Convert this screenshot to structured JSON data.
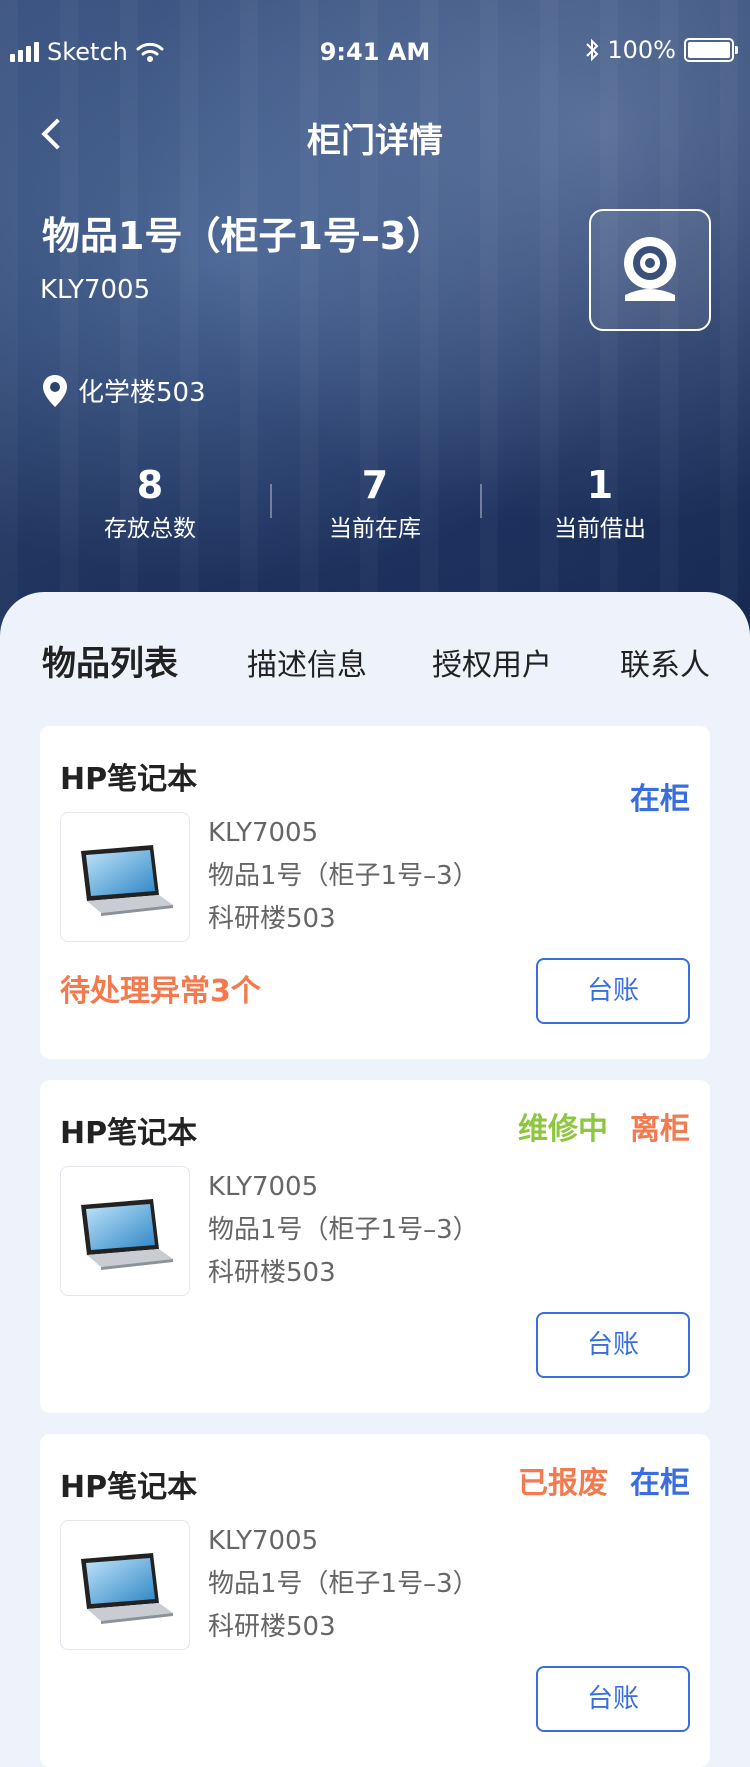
{
  "statusbar": {
    "carrier": "Sketch",
    "time": "9:41 AM",
    "battery": "100%"
  },
  "nav": {
    "title": "柜门详情"
  },
  "cabinet": {
    "title": "物品1号（柜子1号–3）",
    "code": "KLY7005",
    "location": "化学楼503"
  },
  "stats": [
    {
      "value": "8",
      "label": "存放总数"
    },
    {
      "value": "7",
      "label": "当前在库"
    },
    {
      "value": "1",
      "label": "当前借出"
    }
  ],
  "tabs": [
    "物品列表",
    "描述信息",
    "授权用户",
    "联系人"
  ],
  "colors": {
    "blue": "#3a6ee0",
    "orange": "#f27a4e",
    "green": "#8dc63f"
  },
  "items": [
    {
      "name": "HP笔记本",
      "status": [
        {
          "text": "在柜",
          "color": "blue"
        }
      ],
      "code": "KLY7005",
      "cabinet": "物品1号（柜子1号–3）",
      "location": "科研楼503",
      "alert": "待处理异常3个",
      "button": "台账"
    },
    {
      "name": "HP笔记本",
      "status": [
        {
          "text": "维修中",
          "color": "green"
        },
        {
          "text": "离柜",
          "color": "orange"
        }
      ],
      "code": "KLY7005",
      "cabinet": "物品1号（柜子1号–3）",
      "location": "科研楼503",
      "button": "台账"
    },
    {
      "name": "HP笔记本",
      "status": [
        {
          "text": "已报废",
          "color": "orange"
        },
        {
          "text": "在柜",
          "color": "blue"
        }
      ],
      "code": "KLY7005",
      "cabinet": "物品1号（柜子1号–3）",
      "location": "科研楼503",
      "button": "台账"
    }
  ]
}
